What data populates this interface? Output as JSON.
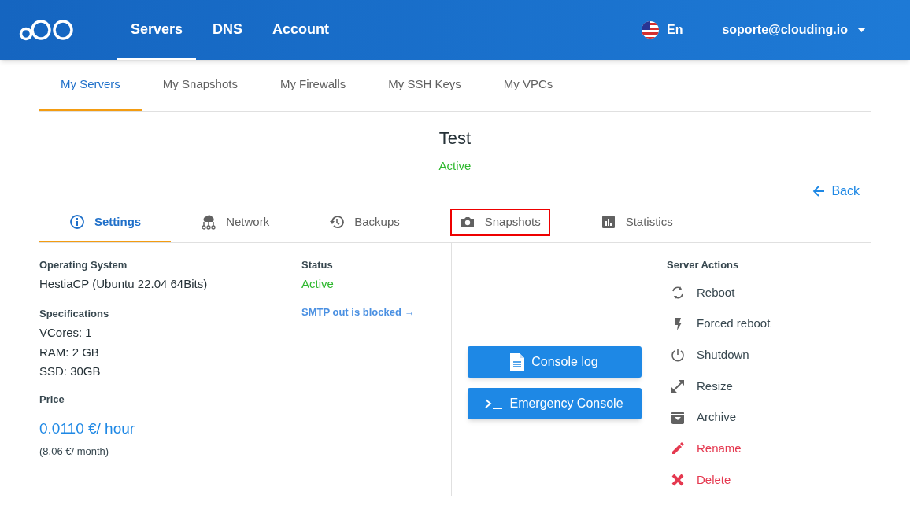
{
  "top_nav": {
    "items": [
      {
        "label": "Servers",
        "selected": true
      },
      {
        "label": "DNS",
        "selected": false
      },
      {
        "label": "Account",
        "selected": false
      }
    ],
    "language": "En",
    "user": "soporte@clouding.io"
  },
  "sub_tabs": [
    {
      "label": "My Servers",
      "selected": true
    },
    {
      "label": "My Snapshots",
      "selected": false
    },
    {
      "label": "My Firewalls",
      "selected": false
    },
    {
      "label": "My SSH Keys",
      "selected": false
    },
    {
      "label": "My VPCs",
      "selected": false
    }
  ],
  "server": {
    "name": "Test",
    "status": "Active",
    "back": "Back"
  },
  "server_tabs": [
    {
      "label": "Settings",
      "kind": "info",
      "selected": true,
      "highlighted": false
    },
    {
      "label": "Network",
      "kind": "network",
      "selected": false,
      "highlighted": false
    },
    {
      "label": "Backups",
      "kind": "history",
      "selected": false,
      "highlighted": false
    },
    {
      "label": "Snapshots",
      "kind": "camera",
      "selected": false,
      "highlighted": true
    },
    {
      "label": "Statistics",
      "kind": "chart",
      "selected": false,
      "highlighted": false
    }
  ],
  "details": {
    "os_label": "Operating System",
    "os": "HestiaCP (Ubuntu 22.04 64Bits)",
    "specs_label": "Specifications",
    "specs": [
      "VCores: 1",
      "RAM: 2 GB",
      "SSD: 30GB"
    ],
    "price_label": "Price",
    "price_hour": "0.0110 €/ hour",
    "price_month": "(8.06 €/ month)",
    "status_label": "Status",
    "status": "Active",
    "smtp_link": "SMTP out is blocked →"
  },
  "console_buttons": [
    {
      "label": "Console log",
      "kind": "file"
    },
    {
      "label": "Emergency Console",
      "kind": "terminal"
    }
  ],
  "actions": {
    "title": "Server Actions",
    "items": [
      {
        "label": "Reboot",
        "kind": "reboot",
        "danger": false
      },
      {
        "label": "Forced reboot",
        "kind": "bolt",
        "danger": false
      },
      {
        "label": "Shutdown",
        "kind": "power",
        "danger": false
      },
      {
        "label": "Resize",
        "kind": "resize",
        "danger": false
      },
      {
        "label": "Archive",
        "kind": "archive",
        "danger": false
      },
      {
        "label": "Rename",
        "kind": "pencil",
        "danger": true
      },
      {
        "label": "Delete",
        "kind": "cross",
        "danger": true
      }
    ]
  }
}
